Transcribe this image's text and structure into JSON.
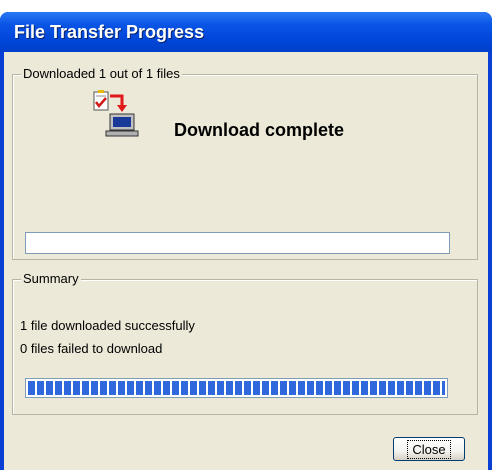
{
  "window": {
    "title": "File Transfer Progress"
  },
  "downloaded_group": {
    "title": "Downloaded 1 out of 1 files",
    "icon": "file-transfer-computer-icon",
    "status": "Download complete",
    "progress_percent": 0
  },
  "summary_group": {
    "title": "Summary",
    "line1": "1 file downloaded successfully",
    "line2": "0 files failed to download",
    "progress_percent": 100
  },
  "buttons": {
    "close_label": "Close"
  },
  "colors": {
    "titlebar": "#0046d8",
    "client_bg": "#ece9d8",
    "progress_fill": "#2f68dc"
  }
}
